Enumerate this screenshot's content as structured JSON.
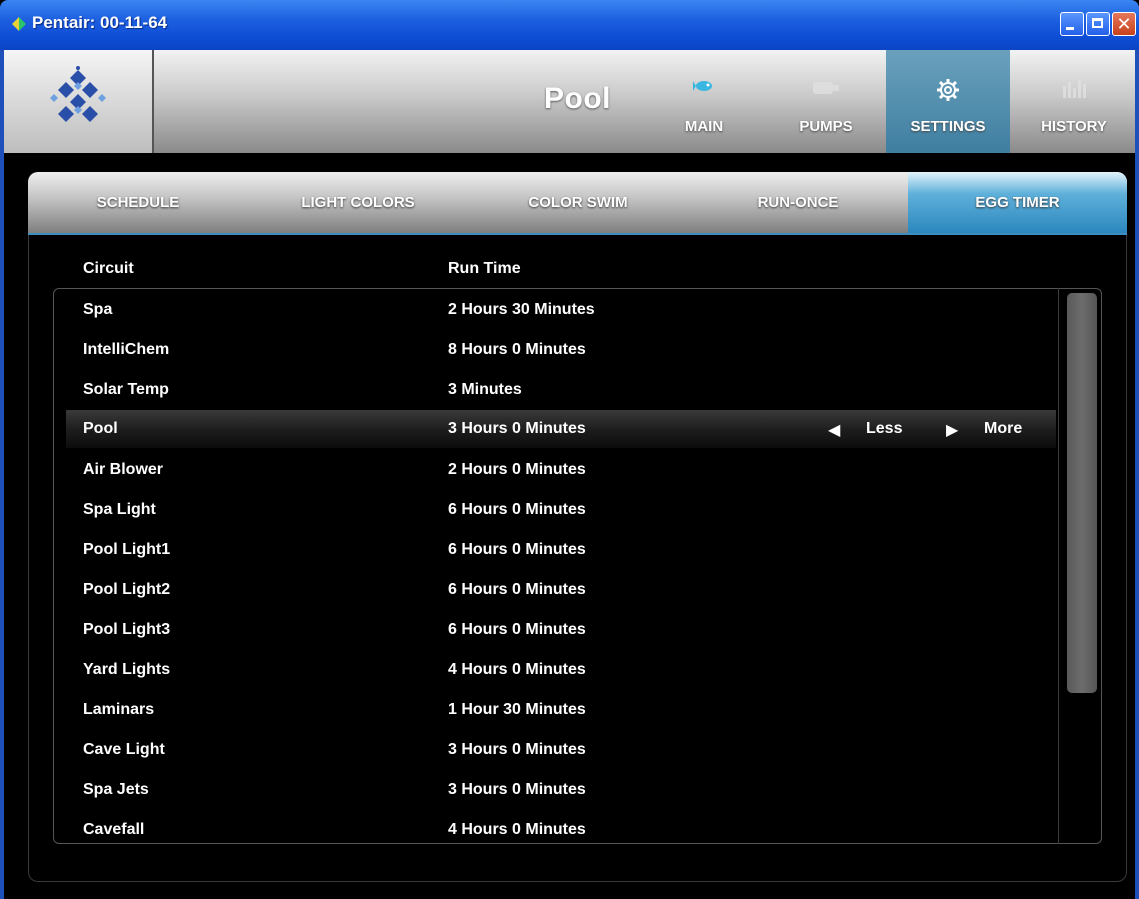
{
  "window": {
    "title": "Pentair: 00-11-64",
    "controls": {
      "minimize_icon": "minimize-icon",
      "maximize_icon": "maximize-icon",
      "close_label": "✕"
    }
  },
  "header": {
    "page_title": "Pool",
    "nav": [
      {
        "label": "MAIN",
        "icon": "pool-fish-icon",
        "active": false
      },
      {
        "label": "PUMPS",
        "icon": "pump-icon",
        "active": false
      },
      {
        "label": "SETTINGS",
        "icon": "gear-icon",
        "active": true
      },
      {
        "label": "HISTORY",
        "icon": "bar-chart-icon",
        "active": false
      }
    ]
  },
  "tabs": [
    {
      "label": "SCHEDULE",
      "active": false
    },
    {
      "label": "LIGHT COLORS",
      "active": false
    },
    {
      "label": "COLOR SWIM",
      "active": false
    },
    {
      "label": "RUN-ONCE",
      "active": false
    },
    {
      "label": "EGG TIMER",
      "active": true
    }
  ],
  "table": {
    "columns": {
      "circuit": "Circuit",
      "run_time": "Run Time"
    },
    "rows": [
      {
        "circuit": "Spa",
        "run_time": "2 Hours 30 Minutes"
      },
      {
        "circuit": "IntelliChem",
        "run_time": "8 Hours 0 Minutes"
      },
      {
        "circuit": "Solar Temp",
        "run_time": "3 Minutes"
      },
      {
        "circuit": "Pool",
        "run_time": "3 Hours 0 Minutes",
        "selected": true
      },
      {
        "circuit": "Air Blower",
        "run_time": "2 Hours 0 Minutes"
      },
      {
        "circuit": "Spa Light",
        "run_time": "6 Hours 0 Minutes"
      },
      {
        "circuit": "Pool Light1",
        "run_time": "6 Hours 0 Minutes"
      },
      {
        "circuit": "Pool Light2",
        "run_time": "6 Hours 0 Minutes"
      },
      {
        "circuit": "Pool Light3",
        "run_time": "6 Hours 0 Minutes"
      },
      {
        "circuit": "Yard Lights",
        "run_time": "4 Hours 0 Minutes"
      },
      {
        "circuit": "Laminars",
        "run_time": "1 Hour 30 Minutes"
      },
      {
        "circuit": "Cave Light",
        "run_time": "3 Hours 0 Minutes"
      },
      {
        "circuit": "Spa Jets",
        "run_time": "3 Hours 0 Minutes"
      },
      {
        "circuit": "Cavefall",
        "run_time": "4 Hours 0 Minutes"
      }
    ],
    "row_controls": {
      "less_label": "Less",
      "more_label": "More",
      "less_arrow": "◀",
      "more_arrow": "▶"
    }
  },
  "colors": {
    "titlebar": "#1d5fe0",
    "active_accent": "#3f7ea0",
    "active_tab": "#2a86bd",
    "background": "#000000",
    "text": "#ffffff"
  }
}
